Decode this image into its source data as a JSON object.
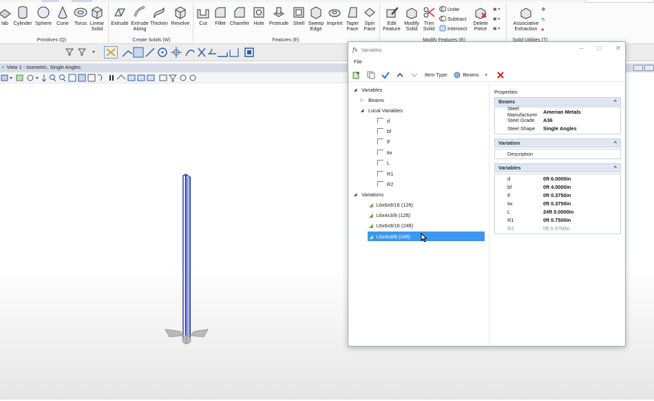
{
  "ribbon": {
    "primitives": [
      "lab",
      "Cylinder",
      "Sphere",
      "Cone",
      "Torus",
      "Linear Solid"
    ],
    "create_solids": [
      "Extrude",
      "Extrude Along",
      "Thicken",
      "Revolve"
    ],
    "features": [
      "Cut",
      "Fillet",
      "Chamfer",
      "Hole",
      "Protrude",
      "Shell",
      "Sweep Edge",
      "Imprint",
      "Taper Face",
      "Spin Face"
    ],
    "modify": [
      "Edit Feature",
      "Modify Solid",
      "Trim Solid"
    ],
    "modify_small": [
      "Unite",
      "Subtract",
      "Intersect"
    ],
    "delete_piece": "Delete Piece",
    "assoc": "Associative Extraction",
    "groups": {
      "primitives": "Primitives (Q)",
      "create_solids": "Create Solids (W)",
      "features": "Features (E)",
      "modify": "Modify Features (R)",
      "solid_utilities": "Solid Utilities (T)"
    }
  },
  "view": {
    "title": "View 1 - Isometric, Single Angles"
  },
  "dialog": {
    "title": "Variables",
    "fx": "fx",
    "menu_file": "File",
    "item_type_label": "Item Type:",
    "item_type_value": "Beams",
    "tree": {
      "root": "Variables",
      "beams": "Beams",
      "local": "Local Variables",
      "locals": [
        "d",
        "bf",
        "tf",
        "tw",
        "L",
        "R1",
        "R2"
      ],
      "variations_label": "Variations",
      "variations": [
        "L6x6x9/16 (12ft)",
        "L6x4x3/8 (12ft)",
        "L6x6x9/16 (24ft)",
        "L6x4x3/8 (24ft)"
      ]
    },
    "properties": {
      "title": "Properties",
      "beams_header": "Beams",
      "beams_rows": [
        {
          "k": "Steel Manufacturer",
          "v": "Amerian Metals"
        },
        {
          "k": "Steel Grade",
          "v": "A36"
        },
        {
          "k": "Steel Shape",
          "v": "Single Angles"
        }
      ],
      "variation_header": "Variation",
      "description_label": "Description",
      "description_value": "",
      "variables_header": "Variables",
      "variable_rows": [
        {
          "k": "d",
          "v": "0ft 6.0000in"
        },
        {
          "k": "bf",
          "v": "0ft 4.0000in"
        },
        {
          "k": "tf",
          "v": "0ft 0.3750in"
        },
        {
          "k": "tw",
          "v": "0ft 0.3750in"
        },
        {
          "k": "L",
          "v": "24ft 0.0000in"
        },
        {
          "k": "R1",
          "v": "0ft 0.7500in"
        },
        {
          "k": "R2",
          "v": "0ft 0.3750in"
        }
      ]
    }
  },
  "colors": {
    "accent": "#3b98f0",
    "beam": "#2b3fbf",
    "header_bg": "#e0e7f2"
  }
}
